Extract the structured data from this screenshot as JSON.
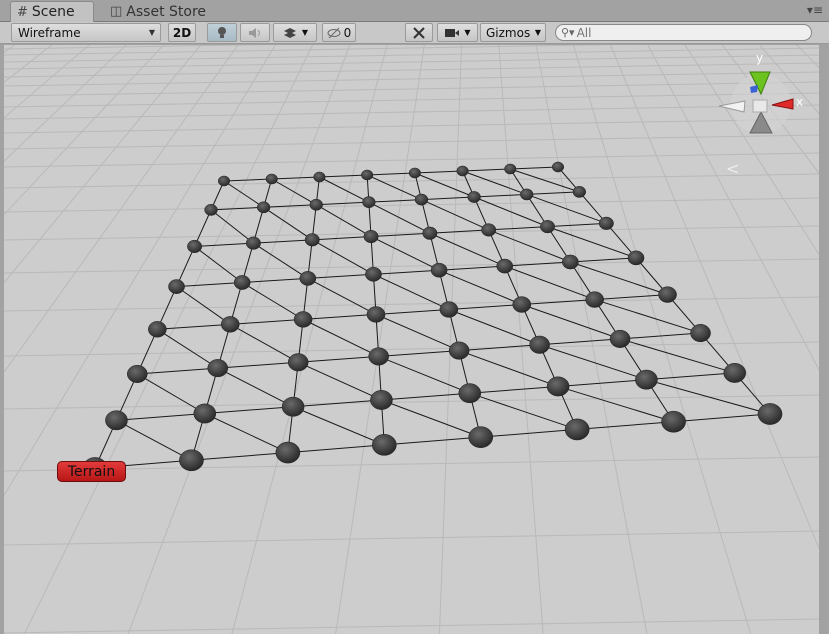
{
  "tabs": [
    {
      "label": "Scene",
      "icon": "grid-icon"
    },
    {
      "label": "Asset Store",
      "icon": "shopping-bag-icon"
    }
  ],
  "toolbar": {
    "shading_mode": "Wireframe",
    "mode_2d": "2D",
    "hidden_count": "0",
    "gizmos": "Gizmos",
    "search_placeholder": "All"
  },
  "gizmo_axes": {
    "y": "y",
    "x": "x"
  },
  "scene": {
    "object_label": "Terrain",
    "rows": 8,
    "cols": 8
  },
  "colors": {
    "viewport_bg": "#cdcdcd",
    "grid_line": "#b9b9b9",
    "vertex": "#3c3c3c",
    "edge": "#1a1a1a",
    "label_bg": "#d22020",
    "axis_y": "#6cc21f",
    "axis_x": "#e02a2a",
    "axis_z": "#3b63d6"
  }
}
